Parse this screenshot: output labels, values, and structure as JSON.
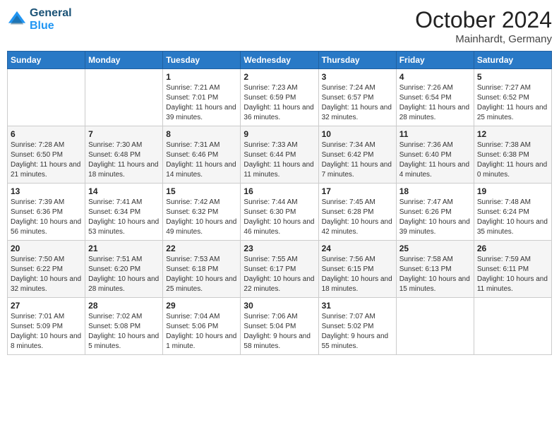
{
  "header": {
    "logo_line1": "General",
    "logo_line2": "Blue",
    "month_title": "October 2024",
    "location": "Mainhardt, Germany"
  },
  "weekdays": [
    "Sunday",
    "Monday",
    "Tuesday",
    "Wednesday",
    "Thursday",
    "Friday",
    "Saturday"
  ],
  "weeks": [
    [
      {
        "day": "",
        "sunrise": "",
        "sunset": "",
        "daylight": ""
      },
      {
        "day": "",
        "sunrise": "",
        "sunset": "",
        "daylight": ""
      },
      {
        "day": "1",
        "sunrise": "Sunrise: 7:21 AM",
        "sunset": "Sunset: 7:01 PM",
        "daylight": "Daylight: 11 hours and 39 minutes."
      },
      {
        "day": "2",
        "sunrise": "Sunrise: 7:23 AM",
        "sunset": "Sunset: 6:59 PM",
        "daylight": "Daylight: 11 hours and 36 minutes."
      },
      {
        "day": "3",
        "sunrise": "Sunrise: 7:24 AM",
        "sunset": "Sunset: 6:57 PM",
        "daylight": "Daylight: 11 hours and 32 minutes."
      },
      {
        "day": "4",
        "sunrise": "Sunrise: 7:26 AM",
        "sunset": "Sunset: 6:54 PM",
        "daylight": "Daylight: 11 hours and 28 minutes."
      },
      {
        "day": "5",
        "sunrise": "Sunrise: 7:27 AM",
        "sunset": "Sunset: 6:52 PM",
        "daylight": "Daylight: 11 hours and 25 minutes."
      }
    ],
    [
      {
        "day": "6",
        "sunrise": "Sunrise: 7:28 AM",
        "sunset": "Sunset: 6:50 PM",
        "daylight": "Daylight: 11 hours and 21 minutes."
      },
      {
        "day": "7",
        "sunrise": "Sunrise: 7:30 AM",
        "sunset": "Sunset: 6:48 PM",
        "daylight": "Daylight: 11 hours and 18 minutes."
      },
      {
        "day": "8",
        "sunrise": "Sunrise: 7:31 AM",
        "sunset": "Sunset: 6:46 PM",
        "daylight": "Daylight: 11 hours and 14 minutes."
      },
      {
        "day": "9",
        "sunrise": "Sunrise: 7:33 AM",
        "sunset": "Sunset: 6:44 PM",
        "daylight": "Daylight: 11 hours and 11 minutes."
      },
      {
        "day": "10",
        "sunrise": "Sunrise: 7:34 AM",
        "sunset": "Sunset: 6:42 PM",
        "daylight": "Daylight: 11 hours and 7 minutes."
      },
      {
        "day": "11",
        "sunrise": "Sunrise: 7:36 AM",
        "sunset": "Sunset: 6:40 PM",
        "daylight": "Daylight: 11 hours and 4 minutes."
      },
      {
        "day": "12",
        "sunrise": "Sunrise: 7:38 AM",
        "sunset": "Sunset: 6:38 PM",
        "daylight": "Daylight: 11 hours and 0 minutes."
      }
    ],
    [
      {
        "day": "13",
        "sunrise": "Sunrise: 7:39 AM",
        "sunset": "Sunset: 6:36 PM",
        "daylight": "Daylight: 10 hours and 56 minutes."
      },
      {
        "day": "14",
        "sunrise": "Sunrise: 7:41 AM",
        "sunset": "Sunset: 6:34 PM",
        "daylight": "Daylight: 10 hours and 53 minutes."
      },
      {
        "day": "15",
        "sunrise": "Sunrise: 7:42 AM",
        "sunset": "Sunset: 6:32 PM",
        "daylight": "Daylight: 10 hours and 49 minutes."
      },
      {
        "day": "16",
        "sunrise": "Sunrise: 7:44 AM",
        "sunset": "Sunset: 6:30 PM",
        "daylight": "Daylight: 10 hours and 46 minutes."
      },
      {
        "day": "17",
        "sunrise": "Sunrise: 7:45 AM",
        "sunset": "Sunset: 6:28 PM",
        "daylight": "Daylight: 10 hours and 42 minutes."
      },
      {
        "day": "18",
        "sunrise": "Sunrise: 7:47 AM",
        "sunset": "Sunset: 6:26 PM",
        "daylight": "Daylight: 10 hours and 39 minutes."
      },
      {
        "day": "19",
        "sunrise": "Sunrise: 7:48 AM",
        "sunset": "Sunset: 6:24 PM",
        "daylight": "Daylight: 10 hours and 35 minutes."
      }
    ],
    [
      {
        "day": "20",
        "sunrise": "Sunrise: 7:50 AM",
        "sunset": "Sunset: 6:22 PM",
        "daylight": "Daylight: 10 hours and 32 minutes."
      },
      {
        "day": "21",
        "sunrise": "Sunrise: 7:51 AM",
        "sunset": "Sunset: 6:20 PM",
        "daylight": "Daylight: 10 hours and 28 minutes."
      },
      {
        "day": "22",
        "sunrise": "Sunrise: 7:53 AM",
        "sunset": "Sunset: 6:18 PM",
        "daylight": "Daylight: 10 hours and 25 minutes."
      },
      {
        "day": "23",
        "sunrise": "Sunrise: 7:55 AM",
        "sunset": "Sunset: 6:17 PM",
        "daylight": "Daylight: 10 hours and 22 minutes."
      },
      {
        "day": "24",
        "sunrise": "Sunrise: 7:56 AM",
        "sunset": "Sunset: 6:15 PM",
        "daylight": "Daylight: 10 hours and 18 minutes."
      },
      {
        "day": "25",
        "sunrise": "Sunrise: 7:58 AM",
        "sunset": "Sunset: 6:13 PM",
        "daylight": "Daylight: 10 hours and 15 minutes."
      },
      {
        "day": "26",
        "sunrise": "Sunrise: 7:59 AM",
        "sunset": "Sunset: 6:11 PM",
        "daylight": "Daylight: 10 hours and 11 minutes."
      }
    ],
    [
      {
        "day": "27",
        "sunrise": "Sunrise: 7:01 AM",
        "sunset": "Sunset: 5:09 PM",
        "daylight": "Daylight: 10 hours and 8 minutes."
      },
      {
        "day": "28",
        "sunrise": "Sunrise: 7:02 AM",
        "sunset": "Sunset: 5:08 PM",
        "daylight": "Daylight: 10 hours and 5 minutes."
      },
      {
        "day": "29",
        "sunrise": "Sunrise: 7:04 AM",
        "sunset": "Sunset: 5:06 PM",
        "daylight": "Daylight: 10 hours and 1 minute."
      },
      {
        "day": "30",
        "sunrise": "Sunrise: 7:06 AM",
        "sunset": "Sunset: 5:04 PM",
        "daylight": "Daylight: 9 hours and 58 minutes."
      },
      {
        "day": "31",
        "sunrise": "Sunrise: 7:07 AM",
        "sunset": "Sunset: 5:02 PM",
        "daylight": "Daylight: 9 hours and 55 minutes."
      },
      {
        "day": "",
        "sunrise": "",
        "sunset": "",
        "daylight": ""
      },
      {
        "day": "",
        "sunrise": "",
        "sunset": "",
        "daylight": ""
      }
    ]
  ]
}
